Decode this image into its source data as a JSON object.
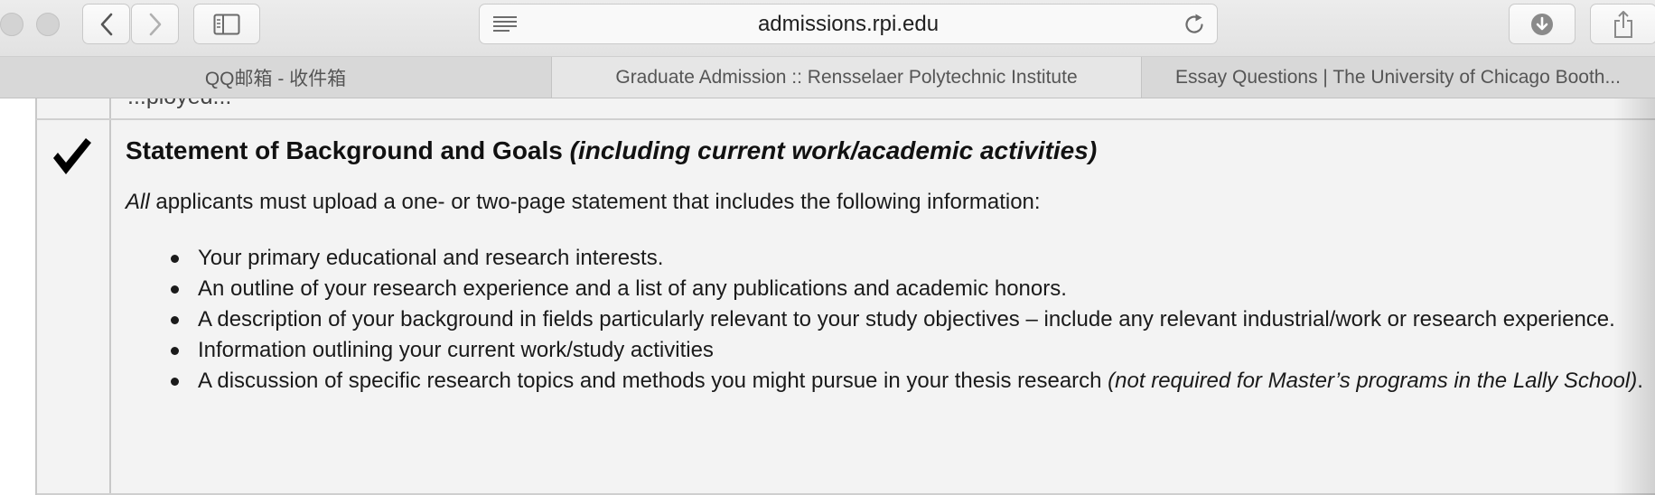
{
  "browser": {
    "url": "admissions.rpi.edu",
    "tabs": [
      {
        "label": "QQ邮箱 - 收件箱",
        "active": false
      },
      {
        "label": "Graduate Admission :: Rensselaer Polytechnic Institute",
        "active": true
      },
      {
        "label": "Essay Questions | The University of Chicago Booth...",
        "active": false
      }
    ]
  },
  "content": {
    "clipped_line": "...ployed...",
    "heading": {
      "main": "Statement of Background and Goals ",
      "italic": "(including current work/academic activities)"
    },
    "intro": {
      "italic": "All",
      "rest": " applicants must upload a one- or two-page statement that includes the following information:"
    },
    "items": [
      {
        "text": "Your primary educational and research interests."
      },
      {
        "text": "An outline of your research experience and a list of any publications and academic honors."
      },
      {
        "text": "A description of your background in fields particularly relevant to your study objectives – include any relevant industrial/work or research experience."
      },
      {
        "text": "Information outlining your current work/study activities"
      },
      {
        "text": "A discussion of specific research topics and methods you might pursue in your thesis research ",
        "italic": "(not required for Master’s programs in the Lally School)",
        "tail": "."
      }
    ]
  }
}
